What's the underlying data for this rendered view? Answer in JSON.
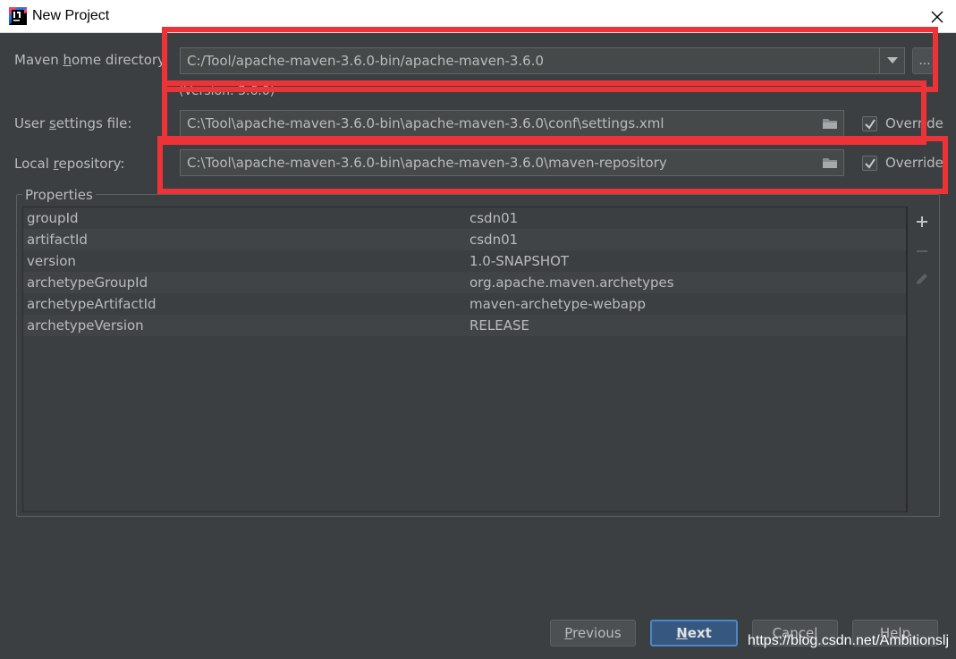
{
  "window": {
    "title": "New Project",
    "app_icon": "intellij-idea-icon",
    "close_icon": "close-icon"
  },
  "maven_home": {
    "label_pre": "Maven ",
    "label_mnemonic": "h",
    "label_post": "ome directory",
    "value": "C:/Tool/apache-maven-3.6.0-bin/apache-maven-3.6.0",
    "browse_label": "...",
    "version": "(Version: 3.6.0)"
  },
  "user_settings": {
    "label_pre": "User ",
    "label_mnemonic": "s",
    "label_post": "ettings file:",
    "value": "C:\\Tool\\apache-maven-3.6.0-bin\\apache-maven-3.6.0\\conf\\settings.xml",
    "override_label": "Override",
    "override_checked": true
  },
  "local_repo": {
    "label_pre": "Local ",
    "label_mnemonic": "r",
    "label_post": "epository:",
    "value": "C:\\Tool\\apache-maven-3.6.0-bin\\apache-maven-3.6.0\\maven-repository",
    "override_label": "Override",
    "override_checked": true
  },
  "properties": {
    "title": "Properties",
    "rows": [
      {
        "key": "groupId",
        "value": "csdn01"
      },
      {
        "key": "artifactId",
        "value": "csdn01"
      },
      {
        "key": "version",
        "value": "1.0-SNAPSHOT"
      },
      {
        "key": "archetypeGroupId",
        "value": "org.apache.maven.archetypes"
      },
      {
        "key": "archetypeArtifactId",
        "value": "maven-archetype-webapp"
      },
      {
        "key": "archetypeVersion",
        "value": "RELEASE"
      }
    ],
    "tools": [
      "plus-icon",
      "minus-icon",
      "pencil-icon"
    ]
  },
  "buttons": {
    "previous_mnemonic": "P",
    "previous_rest": "revious",
    "next_mnemonic": "N",
    "next_rest": "ext",
    "cancel": "Cancel",
    "help": "Help"
  },
  "watermark": "https://blog.csdn.net/Ambitionslj",
  "colors": {
    "annotation": "#ed3338",
    "background": "#3c3f41",
    "primary_button": "#365880"
  }
}
